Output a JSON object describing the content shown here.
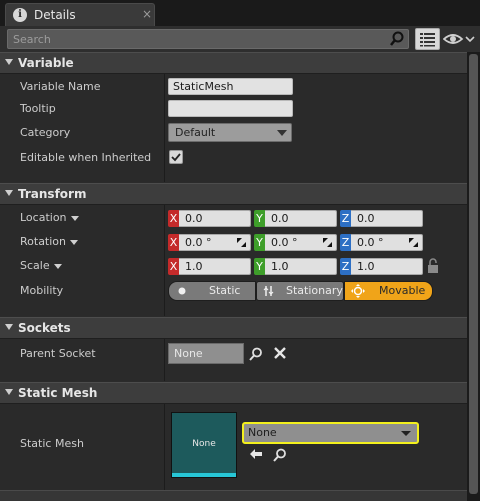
{
  "tab": {
    "title": "Details",
    "close_glyph": "×"
  },
  "search": {
    "placeholder": "Search"
  },
  "sections": {
    "variable": {
      "title": "Variable",
      "variable_name_label": "Variable Name",
      "variable_name_value": "StaticMesh",
      "tooltip_label": "Tooltip",
      "tooltip_value": "",
      "category_label": "Category",
      "category_value": "Default",
      "editable_label": "Editable when Inherited",
      "editable_checked": true
    },
    "transform": {
      "title": "Transform",
      "location_label": "Location",
      "rotation_label": "Rotation",
      "scale_label": "Scale",
      "mobility_label": "Mobility",
      "axis_x": "X",
      "axis_y": "Y",
      "axis_z": "Z",
      "location": [
        "0.0",
        "0.0",
        "0.0"
      ],
      "rotation": [
        "0.0 °",
        "0.0 °",
        "0.0 °"
      ],
      "scale": [
        "1.0",
        "1.0",
        "1.0"
      ],
      "mobility_options": [
        "Static",
        "Stationary",
        "Movable"
      ],
      "mobility_selected": "Movable"
    },
    "sockets": {
      "title": "Sockets",
      "parent_socket_label": "Parent Socket",
      "parent_socket_value": "None"
    },
    "static_mesh": {
      "title": "Static Mesh",
      "static_mesh_label": "Static Mesh",
      "thumbnail_label": "None",
      "mesh_value": "None"
    }
  },
  "colors": {
    "axis_x": "#c42a2a",
    "axis_y": "#3e9e2a",
    "axis_z": "#2d6fc4",
    "mobility_selected": "#f0a419",
    "asset_highlight": "#f3f01e",
    "thumbnail": "#1d5a5c"
  },
  "icons": [
    "info-icon",
    "close-icon",
    "search-icon",
    "list-view-icon",
    "eye-icon",
    "chevron-down-icon",
    "checkmark-icon",
    "reset-to-default-icon",
    "lock-icon",
    "static-icon",
    "stationary-icon",
    "movable-icon",
    "browse-icon",
    "clear-icon",
    "use-selected-icon"
  ]
}
